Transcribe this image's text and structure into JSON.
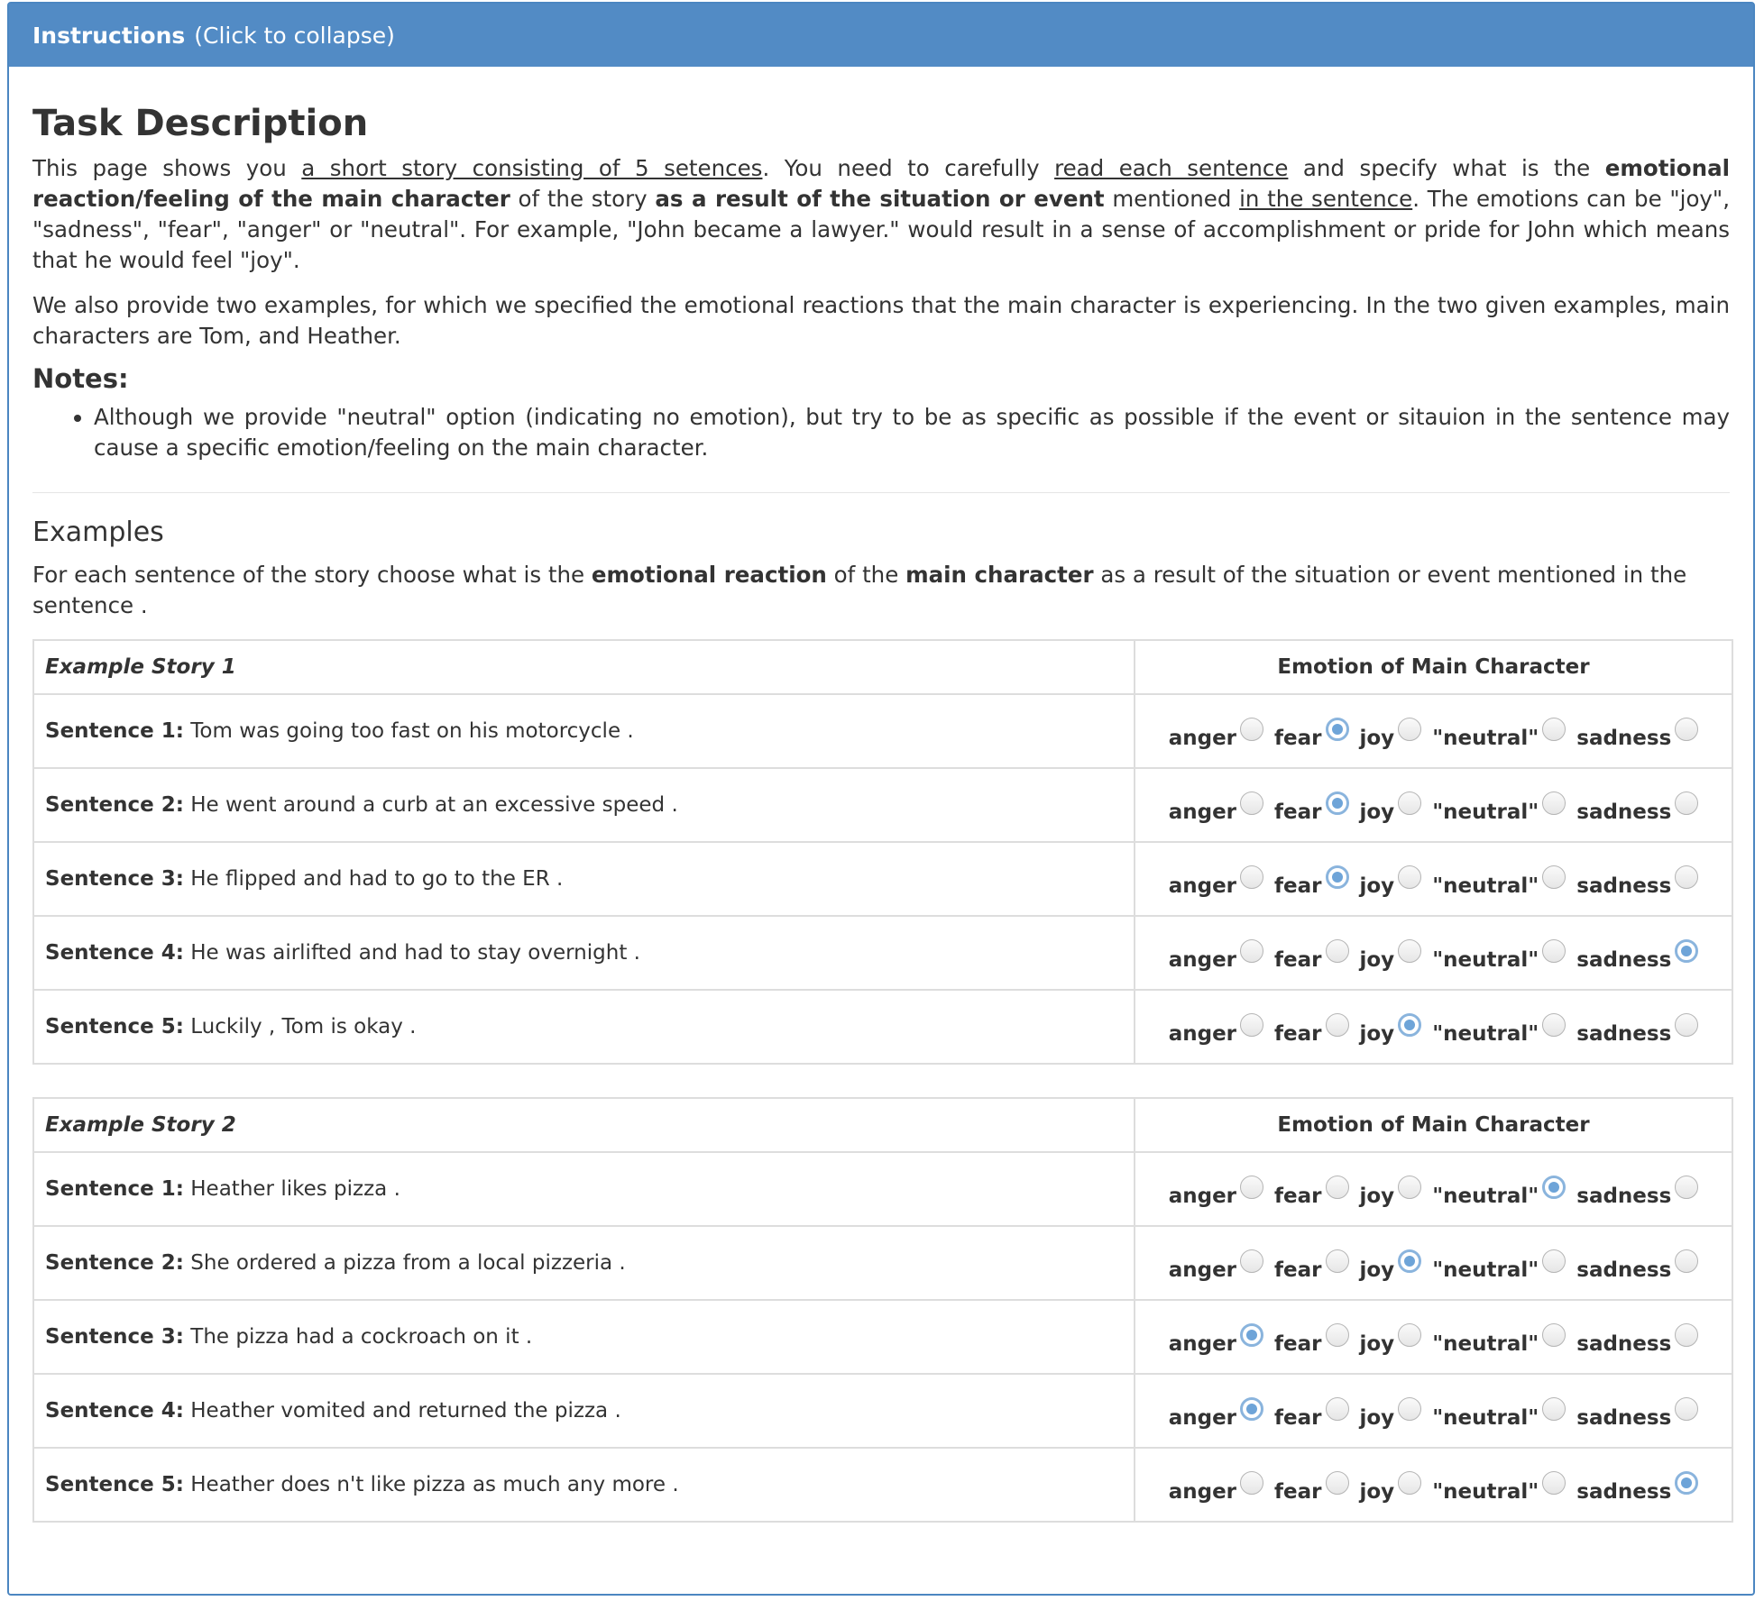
{
  "heading": {
    "title": "Instructions",
    "toggle": "(Click to collapse)"
  },
  "task": {
    "title": "Task Description",
    "p1": {
      "t1": "This page shows you ",
      "u1": "a short story consisting of 5 setences",
      "t2": ". You need to carefully ",
      "u2": "read each sentence",
      "t3": " and specify what is the ",
      "b1": "emotional reaction/feeling of the main character",
      "t4": " of the story ",
      "b2": "as a result of the situation or event",
      "t5": " mentioned ",
      "u3": "in the sentence",
      "t6": ". The emotions can be \"joy\", \"sadness\", \"fear\", \"anger\" or \"neutral\". For example, \"John became a lawyer.\" would result in a sense of accomplishment or pride for John which means that he would feel \"joy\"."
    },
    "p2": "We also provide two examples, for which we specified the emotional reactions that the main character is experiencing. In the two given examples, main characters are Tom, and Heather.",
    "notes_title": "Notes:",
    "note1": "Although we provide \"neutral\" option (indicating no emotion), but try to be as specific as possible if the event or sitauion in the sentence may cause a specific emotion/feeling on the main character."
  },
  "examples": {
    "title": "Examples",
    "intro": {
      "t1": "For each sentence of the story choose what is the ",
      "b1": "emotional reaction",
      "t2": " of the ",
      "b2": "main character",
      "t3": " as a result of the situation or event mentioned in the sentence ."
    }
  },
  "emotion_options": [
    "anger",
    "fear",
    "joy",
    "\"neutral\"",
    "sadness"
  ],
  "stories": [
    {
      "title": "Example Story 1",
      "column_header": "Emotion of Main Character",
      "sentences": [
        {
          "label": "Sentence 1:",
          "text": " Tom was going too fast on his motorcycle .",
          "selected": "fear"
        },
        {
          "label": "Sentence 2:",
          "text": " He went around a curb at an excessive speed .",
          "selected": "fear"
        },
        {
          "label": "Sentence 3:",
          "text": " He flipped and had to go to the ER .",
          "selected": "fear"
        },
        {
          "label": "Sentence 4:",
          "text": " He was airlifted and had to stay overnight .",
          "selected": "sadness"
        },
        {
          "label": "Sentence 5:",
          "text": " Luckily , Tom is okay .",
          "selected": "joy"
        }
      ]
    },
    {
      "title": "Example Story 2",
      "column_header": "Emotion of Main Character",
      "sentences": [
        {
          "label": "Sentence 1:",
          "text": " Heather likes pizza .",
          "selected": "\"neutral\""
        },
        {
          "label": "Sentence 2:",
          "text": " She ordered a pizza from a local pizzeria .",
          "selected": "joy"
        },
        {
          "label": "Sentence 3:",
          "text": " The pizza had a cockroach on it .",
          "selected": "anger"
        },
        {
          "label": "Sentence 4:",
          "text": " Heather vomited and returned the pizza .",
          "selected": "anger"
        },
        {
          "label": "Sentence 5:",
          "text": " Heather does n't like pizza as much any more .",
          "selected": "sadness"
        }
      ]
    }
  ]
}
